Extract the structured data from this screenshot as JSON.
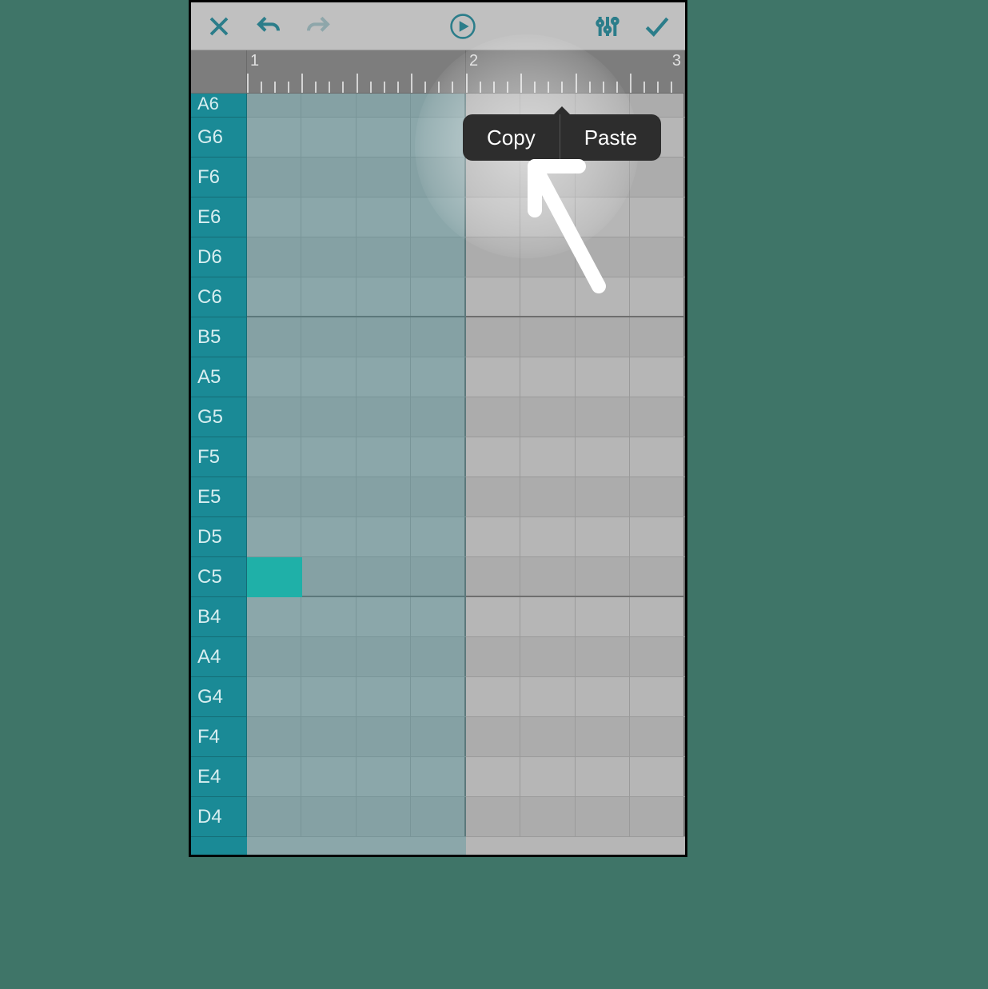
{
  "toolbar": {
    "close": "Close",
    "undo": "Undo",
    "redo": "Redo",
    "play": "Play",
    "mixer": "Mixer",
    "done": "Done"
  },
  "ruler": {
    "bars": [
      "1",
      "2",
      "3"
    ]
  },
  "keys": [
    "A6",
    "G6",
    "F6",
    "E6",
    "D6",
    "C6",
    "B5",
    "A5",
    "G5",
    "F5",
    "E5",
    "D5",
    "C5",
    "B4",
    "A4",
    "G4",
    "F4",
    "E4",
    "D4"
  ],
  "context_menu": {
    "copy": "Copy",
    "paste": "Paste"
  },
  "notes": [
    {
      "row": "C5",
      "col": 0,
      "span": 1
    }
  ],
  "selection": {
    "start_bar": 1,
    "end_bar": 1
  },
  "colors": {
    "accent": "#1a8a96",
    "note": "#1fb0a8",
    "menu_bg": "#2d2d2d"
  }
}
